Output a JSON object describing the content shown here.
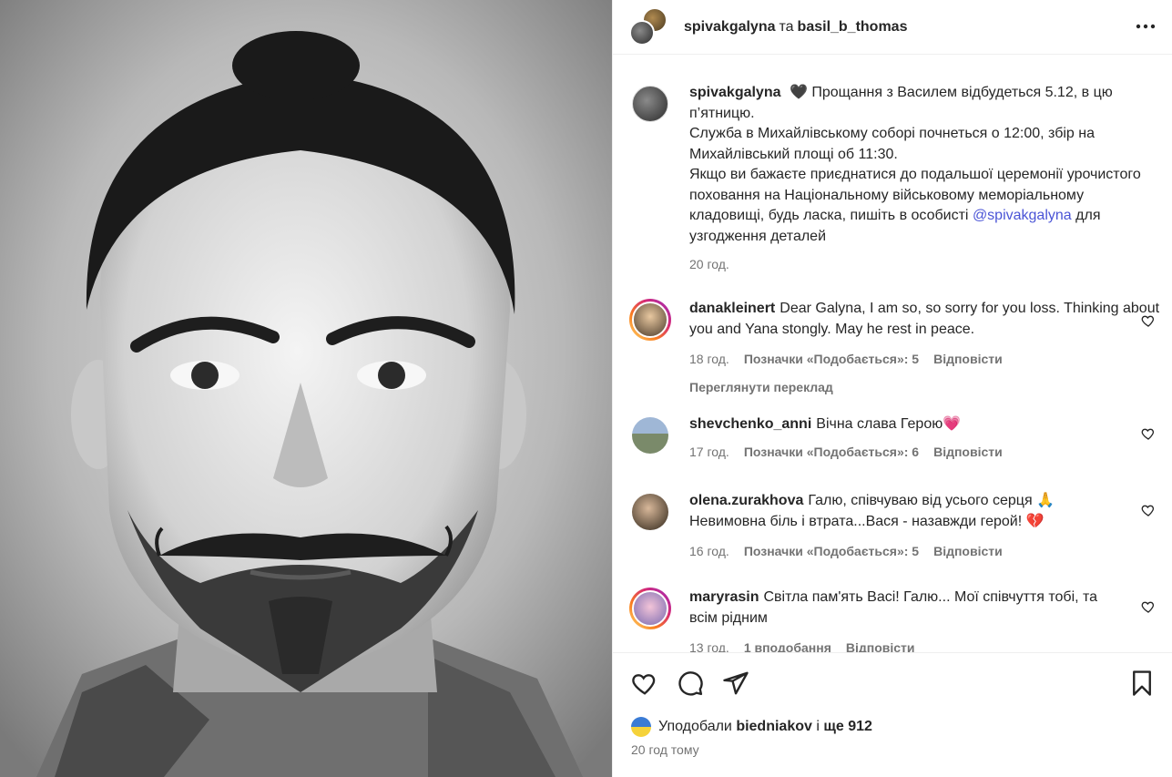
{
  "header": {
    "user1": "spivakgalyna",
    "joiner": "та",
    "user2": "basil_b_thomas",
    "more_icon": "more-horizontal-icon"
  },
  "caption": {
    "username": "spivakgalyna",
    "heart": "🖤",
    "line1": "Прощання з Василем відбудеться 5.12, в цю п’ятницю.",
    "line2": "Служба в Михайлівському соборі почнеться о 12:00, збір на Михайлівський площі об 11:30.",
    "line3": "Якщо ви бажаєте приєднатися до подальшої церемонії урочистого поховання на Національному військовому меморіальному кладовищі, будь ласка, пишіть в особисті",
    "mention": "@spivakgalyna",
    "line3_end": "для узгодження деталей",
    "time": "20 год."
  },
  "comments": [
    {
      "username": "danakleinert",
      "text": "Dear Galyna, I am so, so sorry for you loss. Thinking about you and Yana stongly. May he rest in peace.",
      "time": "18 год.",
      "likes": "Позначки «Подобається»: 5",
      "reply": "Відповісти",
      "translate": "Переглянути переклад"
    },
    {
      "username": "shevchenko_anni",
      "text": "Вічна слава Герою💗",
      "time": "17 год.",
      "likes": "Позначки «Подобається»: 6",
      "reply": "Відповісти"
    },
    {
      "username": "olena.zurakhova",
      "text": "Галю, співчуваю від усього серця 🙏 Невимовна біль і втрата...Вася - назавжди герой! 💔",
      "time": "16 год.",
      "likes": "Позначки «Подобається»: 5",
      "reply": "Відповісти"
    },
    {
      "username": "maryrasin",
      "text": "Світла пам'ять Васі! Галю... Мої співчуття тобі, та всім рідним",
      "time": "13 год.",
      "likes": "1 вподобання",
      "reply": "Відповісти"
    }
  ],
  "actions": {
    "liked_prefix": "Уподобали",
    "liked_user": "biedniakov",
    "liked_and": "і",
    "liked_rest": "ще 912",
    "ago": "20 год тому"
  }
}
